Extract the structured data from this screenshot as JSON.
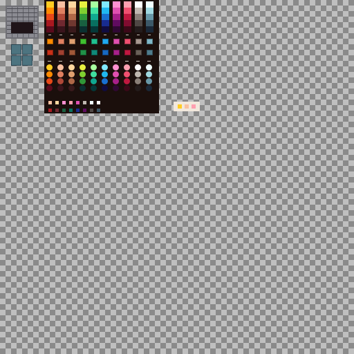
{
  "tileset": {
    "stone_tile_icon": "stone-wall-tile",
    "teal_tile_icon": "teal-floor-tile",
    "stone_colors": {
      "light": "#8b8b92",
      "mid": "#5f5f66",
      "dark": "#4b4b52",
      "frame": "#6f6f75",
      "gap": "#1f1418"
    },
    "teal_colors": {
      "fill": "#4d7480",
      "edge": "#2a4552"
    }
  },
  "palette": {
    "background": "#1b0f0c",
    "ramps": [
      [
        "#ffcc22",
        "#ff8a00",
        "#e84818",
        "#a81820",
        "#5a0a1c"
      ],
      [
        "#f8c0a0",
        "#e08060",
        "#b04838",
        "#702830",
        "#3a141c"
      ],
      [
        "#ffd8a0",
        "#e0a070",
        "#b06848",
        "#703830",
        "#3a1a1c"
      ],
      [
        "#e8f040",
        "#80d030",
        "#309838",
        "#186040",
        "#0a3030"
      ],
      [
        "#a8ffa0",
        "#40e0a0",
        "#10a890",
        "#087060",
        "#043838"
      ],
      [
        "#80e8ff",
        "#20b8f0",
        "#1870d0",
        "#182c90",
        "#100c40"
      ],
      [
        "#ff90d0",
        "#e050b0",
        "#a8208a",
        "#600c60",
        "#300834"
      ],
      [
        "#ffa0b0",
        "#f05070",
        "#c01840",
        "#800c30",
        "#3c0818"
      ],
      [
        "#ffffff",
        "#c0b8b0",
        "#8a7f78",
        "#4f4744",
        "#241c1c"
      ],
      [
        "#f0ffff",
        "#a0d8e0",
        "#6898a8",
        "#3c5868",
        "#1a2838"
      ]
    ],
    "swatch_colors_row1": [
      "#ff8a00",
      "#e08060",
      "#e0a070",
      "#40c030",
      "#20c090",
      "#20a8f0",
      "#e050b0",
      "#f05070",
      "#a89890",
      "#80b8c8"
    ],
    "swatch_colors_row2": [
      "#c83018",
      "#a04030",
      "#a05838",
      "#209048",
      "#108878",
      "#1868c0",
      "#a8208a",
      "#c01840",
      "#6a6058",
      "#4f7c8c"
    ],
    "dot_colors": [
      [
        "#ffcc22",
        "#ff8a00",
        "#e84818",
        "#5a0a1c"
      ],
      [
        "#f8c0a0",
        "#e08060",
        "#b04838",
        "#3a141c"
      ],
      [
        "#ffd8a0",
        "#e0a070",
        "#b06848",
        "#3a1a1c"
      ],
      [
        "#e8f040",
        "#80d030",
        "#309838",
        "#0a3030"
      ],
      [
        "#a8ffa0",
        "#40e0a0",
        "#10a890",
        "#043838"
      ],
      [
        "#80e8ff",
        "#20b8f0",
        "#1870d0",
        "#100c40"
      ],
      [
        "#ff90d0",
        "#e050b0",
        "#a8208a",
        "#300834"
      ],
      [
        "#ffa0b0",
        "#f05070",
        "#c01840",
        "#3c0818"
      ],
      [
        "#ffffff",
        "#c0b8b0",
        "#8a7f78",
        "#241c1c"
      ],
      [
        "#f0ffff",
        "#a0d8e0",
        "#6898a8",
        "#1a2838"
      ]
    ],
    "mini_row1": [
      "#f8c0a0",
      "#ffd8a0",
      "#ff90d0",
      "#ffa0b0",
      "#e050b0",
      "#c0b8b0",
      "#f0ffff",
      "#ffffff"
    ],
    "mini_row2": [
      "#a81820",
      "#702830",
      "#186040",
      "#087060",
      "#182c90",
      "#600c60",
      "#4f4744",
      "#3c5868"
    ],
    "badge_colors": [
      "#ffcc22",
      "#f8c0a0",
      "#ffa0b0"
    ]
  }
}
